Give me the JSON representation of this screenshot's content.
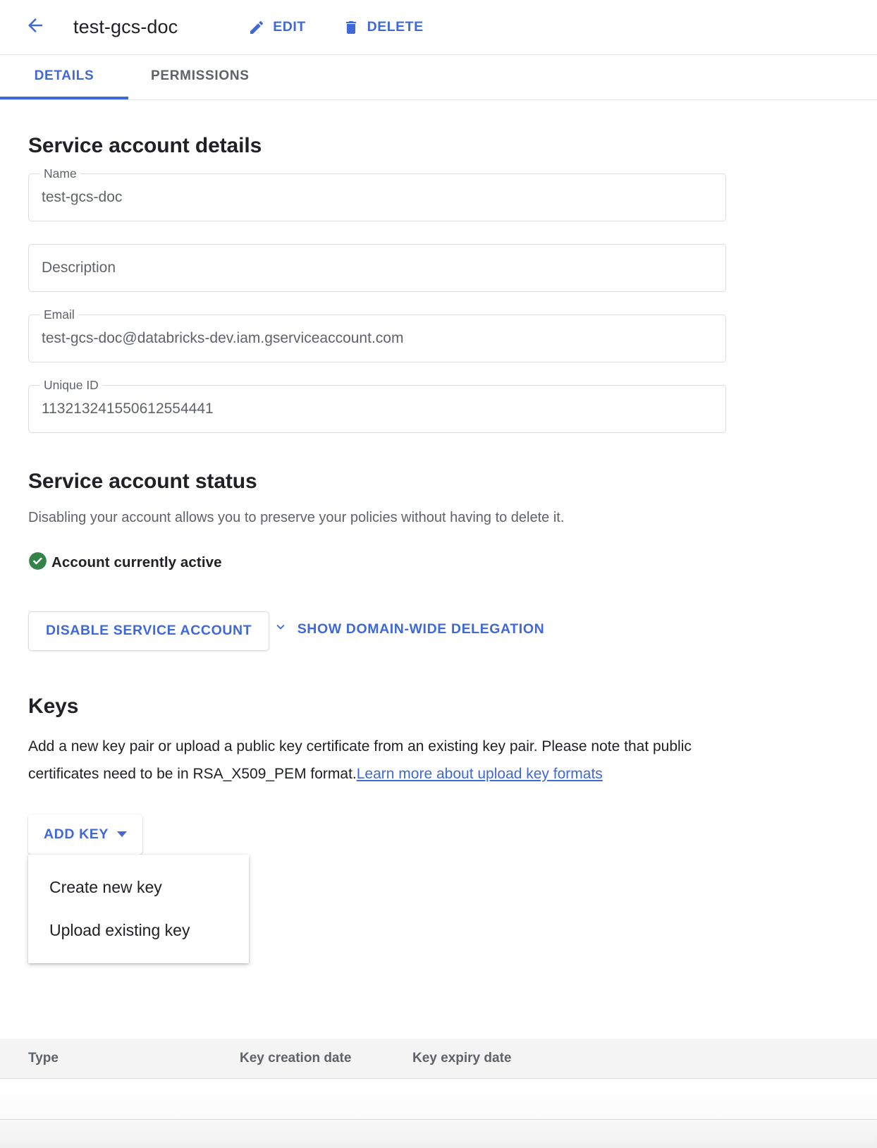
{
  "appbar": {
    "back_icon": "arrow-back-icon",
    "title": "test-gcs-doc",
    "actions": [
      {
        "label": "EDIT",
        "icon": "pencil-icon"
      },
      {
        "label": "DELETE",
        "icon": "trash-icon"
      }
    ]
  },
  "tabs": [
    {
      "label": "DETAILS",
      "active": true
    },
    {
      "label": "PERMISSIONS",
      "active": false
    }
  ],
  "details": {
    "heading": "Service account details",
    "fields": [
      {
        "legend": "Name",
        "value": "test-gcs-doc",
        "placeholder": ""
      },
      {
        "legend": "",
        "value": "",
        "placeholder": "Description"
      },
      {
        "legend": "Email",
        "value": "test-gcs-doc@databricks-dev.iam.gserviceaccount.com",
        "placeholder": ""
      },
      {
        "legend": "Unique ID",
        "value": "113213241550612554441",
        "placeholder": ""
      }
    ]
  },
  "status": {
    "heading": "Service account status",
    "helper": "Disabling your account allows you to preserve your policies without having to delete it.",
    "state_icon": "check-circle-icon",
    "state_label": "Account currently active",
    "disable_button": "DISABLE SERVICE ACCOUNT",
    "delegation_toggle": "SHOW DOMAIN-WIDE DELEGATION",
    "delegation_icon": "chevron-down-icon"
  },
  "keys": {
    "heading": "Keys",
    "description_part1": "Add a new key pair or upload a public key certificate from an existing key pair. Please note that public certificates need to be in RSA_X509_PEM format.",
    "description_link": "Learn more about upload key formats",
    "add_key_button": "ADD KEY",
    "add_key_caret": "caret-down-icon",
    "menu_items": [
      "Create new key",
      "Upload existing key"
    ],
    "table": {
      "columns": [
        "Type",
        "Key creation date",
        "Key expiry date"
      ],
      "rows": []
    }
  },
  "colors": {
    "accent_blue": "#3f68d8",
    "active_green": "#34834a",
    "text_primary": "#202124",
    "text_secondary": "#5f6368",
    "border": "#dadce0",
    "table_header_bg": "#f4f4f5"
  }
}
